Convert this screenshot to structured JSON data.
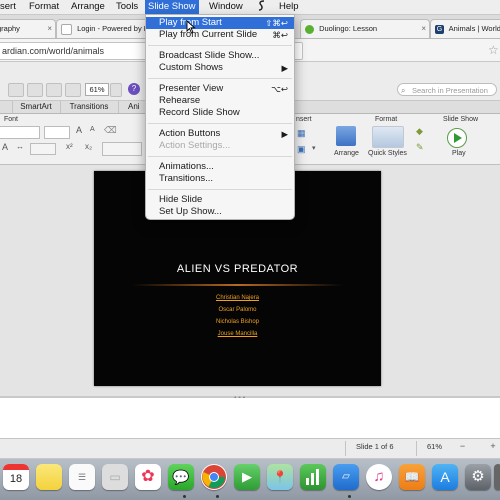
{
  "menubar": {
    "items": [
      {
        "label": "sert",
        "active": false
      },
      {
        "label": "Format",
        "active": false
      },
      {
        "label": "Arrange",
        "active": false
      },
      {
        "label": "Tools",
        "active": false
      },
      {
        "label": "Slide Show",
        "active": true
      },
      {
        "label": "Window",
        "active": false
      },
      {
        "label": "Help",
        "active": false
      }
    ],
    "script_icon": "script-icon"
  },
  "browser": {
    "tabs": [
      {
        "label": "graphy"
      },
      {
        "label": "Login - Powered by B"
      },
      {
        "label": "Duolingo: Lesson"
      },
      {
        "label": "Animals | World"
      }
    ],
    "url": "ardian.com/world/animals"
  },
  "toolbar": {
    "zoom": "61%",
    "help": "?",
    "search_placeholder": "Search in Presentation"
  },
  "ribbon": {
    "tabs": [
      "SmartArt",
      "Transitions",
      "Ani"
    ],
    "groups": {
      "font": "Font",
      "insert": "nsert",
      "format": "Format",
      "slide_show": "Slide Show"
    },
    "buttons": {
      "arrange": "Arrange",
      "quick_styles": "Quick Styles",
      "play": "Play"
    }
  },
  "slide_show_menu": {
    "items": [
      {
        "label": "Play from Start",
        "shortcut": "⇧⌘↩"
      },
      {
        "label": "Play from Current Slide",
        "shortcut": "⌘↩"
      },
      {
        "label": "Broadcast Slide Show..."
      },
      {
        "label": "Custom Shows"
      },
      {
        "label": "Presenter View",
        "shortcut": "⌥↩"
      },
      {
        "label": "Rehearse"
      },
      {
        "label": "Record Slide Show"
      },
      {
        "label": "Action Buttons"
      },
      {
        "label": "Action Settings..."
      },
      {
        "label": "Animations..."
      },
      {
        "label": "Transitions..."
      },
      {
        "label": "Hide Slide"
      },
      {
        "label": "Set Up Show..."
      }
    ],
    "highlighted": "Play from Start",
    "disabled": [
      "Action Settings..."
    ]
  },
  "slide": {
    "title": "ALIEN VS PREDATOR",
    "credits": [
      "Christian Najera",
      "Oscar Palomo",
      "Nicholas Bishop",
      "Jouse Mancilla"
    ],
    "text_color": "#f0a020"
  },
  "statusbar": {
    "slide_count": "Slide 1 of 6",
    "zoom": "61%",
    "minus": "−",
    "plus": "+"
  },
  "dock": {
    "calendar_day": "18",
    "apps": [
      "calendar-icon",
      "notes-icon",
      "reminders-icon",
      "photos-icon",
      "messages-icon",
      "chrome-icon",
      "facetime-icon",
      "maps-icon",
      "numbers-icon",
      "keynote-icon",
      "itunes-icon",
      "ibooks-icon",
      "app-store-icon",
      "system-preferences-icon"
    ]
  },
  "colors": {
    "menu_highlight": "#2f6fd7",
    "slide_background": "#050505",
    "credit_text": "#f0a020"
  }
}
